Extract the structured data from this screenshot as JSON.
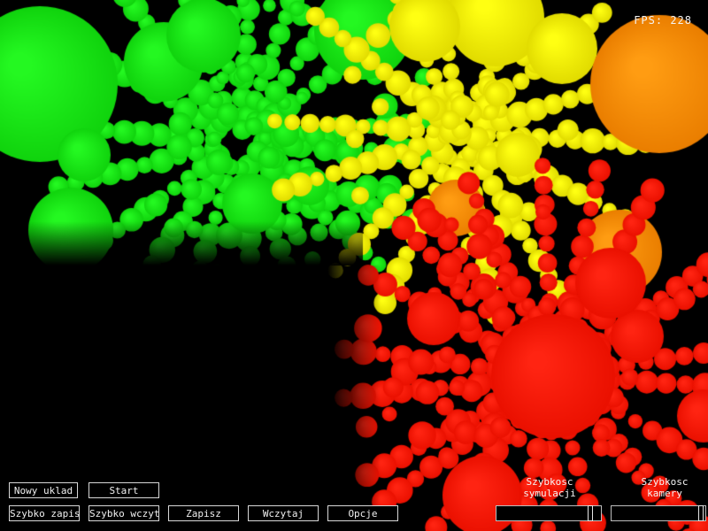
{
  "hud": {
    "fps": "FPS: 228"
  },
  "buttons": {
    "new_layout": "Nowy uklad",
    "start": "Start",
    "quick_save": "Szybko zapisz",
    "quick_load": "Szybko wczytaj",
    "save": "Zapisz",
    "load": "Wczytaj",
    "options": "Opcje"
  },
  "sliders": {
    "simulation_speed": {
      "label_line1": "Szybkosc",
      "label_line2": "symulacji",
      "value": 0.92
    },
    "camera_speed": {
      "label_line1": "Szybkosc",
      "label_line2": "kamery",
      "value": 0.98
    }
  },
  "colors": {
    "green": "#12e60f",
    "yellow": "#f5ef00",
    "orange": "#ff8a00",
    "red": "#ff1200"
  }
}
